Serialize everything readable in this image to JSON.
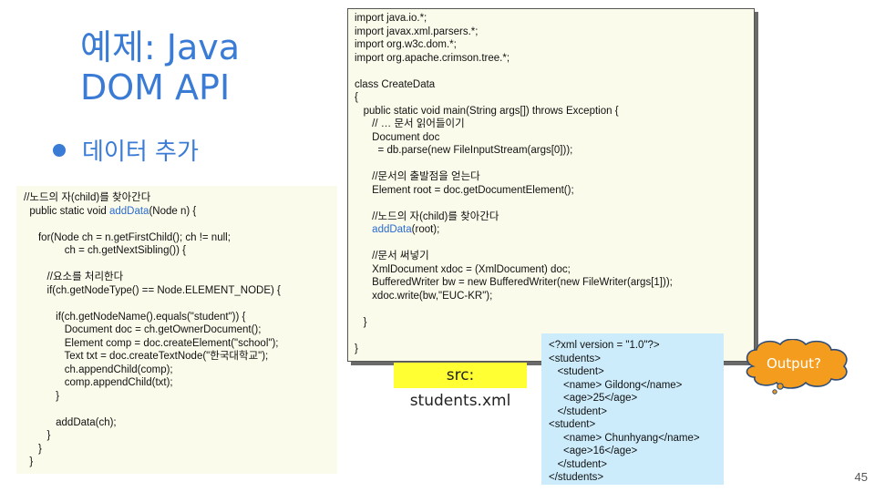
{
  "slide": {
    "title_line1": "예제: Java",
    "title_line2": "DOM API",
    "bullet": "데이터 추가",
    "page_number": "45"
  },
  "left_code": {
    "l1": "//노드의 자(child)를 찾아간다",
    "l2a": "  public static void ",
    "l2b": "addData",
    "l2c": "(Node n) {",
    "l3": "     for(Node ch = n.getFirstChild(); ch != null;",
    "l4": "              ch = ch.getNextSibling()) {",
    "l5": "        //요소를 처리한다",
    "l6": "        if(ch.getNodeType() == Node.ELEMENT_NODE) {",
    "l7": "           if(ch.getNodeName().equals(\"student\")) {",
    "l8": "              Document doc = ch.getOwnerDocument();",
    "l9": "              Element comp = doc.createElement(\"school\");",
    "l10": "              Text txt = doc.createTextNode(\"한국대학교\");",
    "l11": "              ch.appendChild(comp);",
    "l12": "              comp.appendChild(txt);",
    "l13": "           }",
    "l14": "           addData(ch);",
    "l15": "        }",
    "l16": "     }",
    "l17": "  }"
  },
  "right_code": {
    "r1": "import java.io.*;",
    "r2": "import javax.xml.parsers.*;",
    "r3": "import org.w3c.dom.*;",
    "r4": "import org.apache.crimson.tree.*;",
    "r5": "class CreateData",
    "r6": "{",
    "r7": "   public static void main(String args[]) throws Exception {",
    "r8": "      // … 문서 읽어들이기",
    "r9": "      Document doc",
    "r10": "        = db.parse(new FileInputStream(args[0]));",
    "r11": "      //문서의 출발점을 얻는다",
    "r12": "      Element root = doc.getDocumentElement();",
    "r13": "      //노드의 자(child)를 찾아간다",
    "r14a": "      ",
    "r14b": "addData",
    "r14c": "(root);",
    "r15": "      //문서 써넣기",
    "r16": "      XmlDocument xdoc = (XmlDocument) doc;",
    "r17": "      BufferedWriter bw = new BufferedWriter(new FileWriter(args[1]));",
    "r18": "      xdoc.write(bw,\"EUC-KR\");",
    "r19": "   }",
    "r20": "}"
  },
  "src_label": "src: students.xml",
  "xml_source": {
    "x1": "<?xml version = \"1.0\"?>",
    "x2": "<students>",
    "x3": "   <student>",
    "x4": "     <name> Gildong</name>",
    "x5": "     <age>25</age>",
    "x6": "   </student>",
    "x7": "<student>",
    "x8": "     <name> Chunhyang</name>",
    "x9": "     <age>16</age>",
    "x10": "   </student>",
    "x11": "</students>"
  },
  "output_bubble": "Output?",
  "colors": {
    "title_blue": "#3a7bd5",
    "code_bg": "#fbfbec",
    "xml_bg": "#ccecfb",
    "label_yellow": "#ffff33",
    "bubble_orange": "#f39c1e"
  }
}
